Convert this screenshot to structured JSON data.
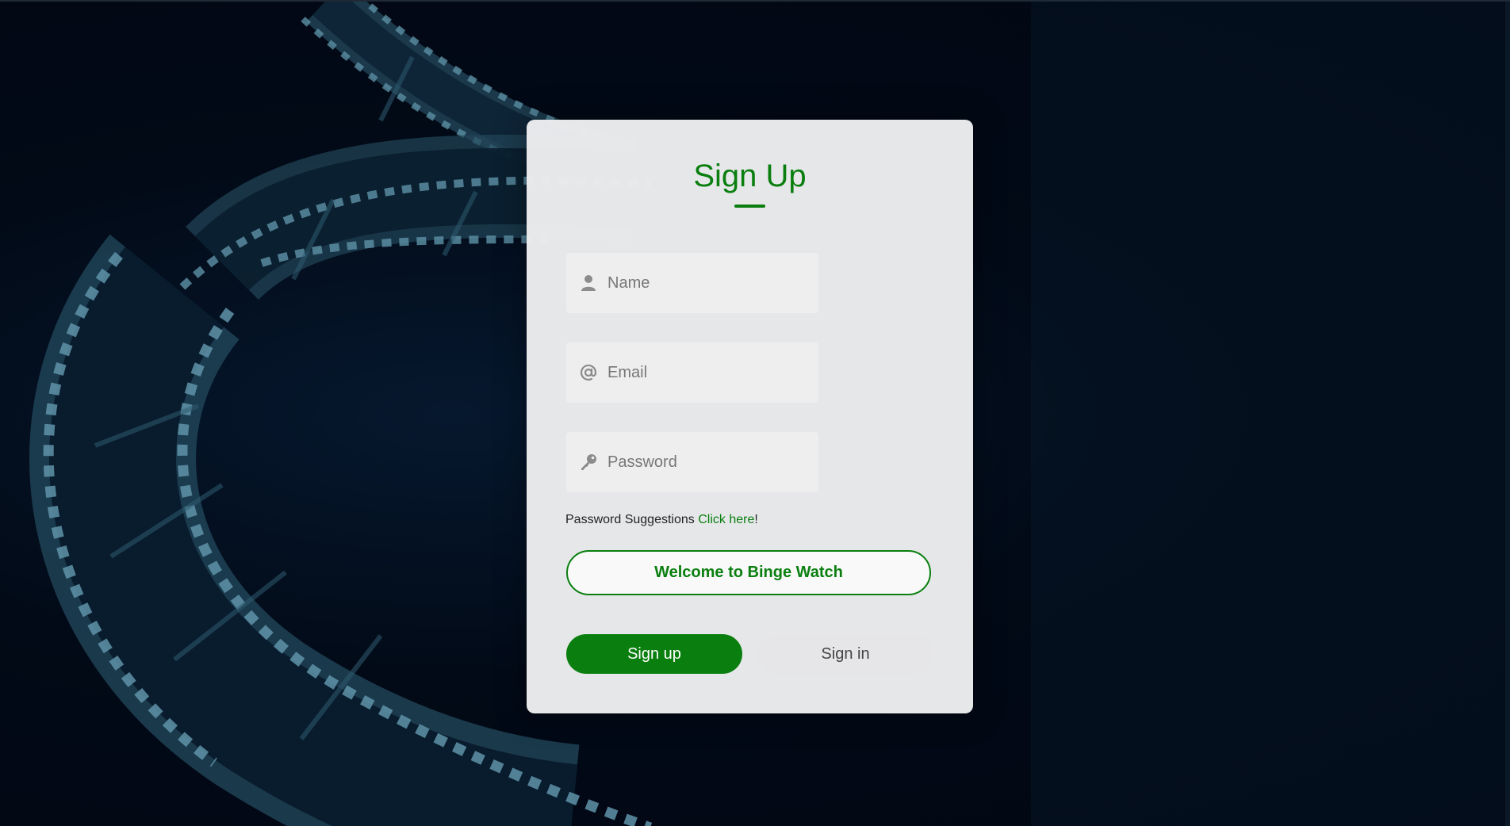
{
  "form": {
    "title": "Sign Up",
    "fields": [
      {
        "icon": "user-icon",
        "placeholder": "Name",
        "value": ""
      },
      {
        "icon": "at-icon",
        "placeholder": "Email",
        "value": ""
      },
      {
        "icon": "key-icon",
        "placeholder": "Password",
        "value": ""
      }
    ],
    "password_hint": "Password Suggestions",
    "password_hint_link": "Click here",
    "password_hint_suffix": "!",
    "welcome_label": "Welcome to Binge Watch",
    "signup_label": "Sign up",
    "signin_label": "Sign in"
  },
  "colors": {
    "accent": "#0a7f0f",
    "card": "#eaebed",
    "background": "#020a17"
  }
}
